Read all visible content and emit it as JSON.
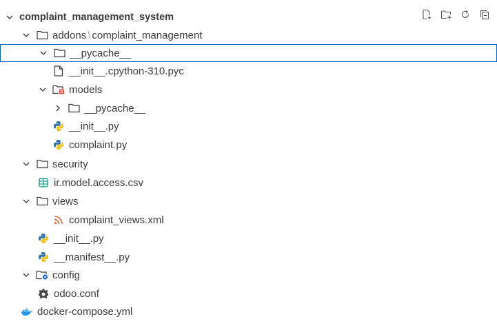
{
  "explorer": {
    "root_label": "complaint_management_system",
    "addons_folder": "addons",
    "addons_subfolder": "complaint_management",
    "pycache_folder": "__pycache__",
    "init_pyc": "__init__.cpython-310.pyc",
    "models_folder": "models",
    "models_pycache": "__pycache__",
    "models_init": "__init__.py",
    "models_complaint": "complaint.py",
    "security_folder": "security",
    "access_csv": "ir.model.access.csv",
    "views_folder": "views",
    "views_xml": "complaint_views.xml",
    "init_py": "__init__.py",
    "manifest_py": "__manifest__.py",
    "config_folder": "config",
    "odoo_conf": "odoo.conf",
    "docker_compose": "docker-compose.yml"
  },
  "icons": {
    "python_blue": "#3572a5",
    "python_yellow": "#f0c419",
    "csv_teal": "#1e9e8e",
    "xml_orange": "#e5662a",
    "docker_blue": "#2496ed",
    "models_badge_red": "#e0443e",
    "config_badge_blue": "#1e6fd9"
  }
}
